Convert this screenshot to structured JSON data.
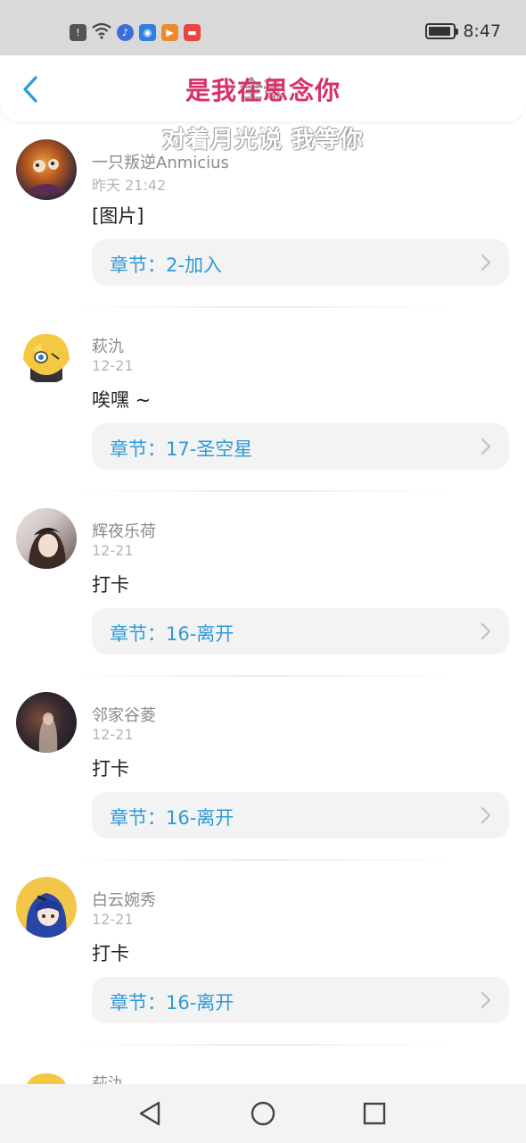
{
  "status_bar": {
    "time": "8:47",
    "battery_level": 0.9,
    "icons": [
      "alert-icon",
      "wifi-icon",
      "music-app-icon",
      "lightbulb-app-icon",
      "video-app-icon",
      "store-app-icon"
    ]
  },
  "header": {
    "title": "是我在思念你",
    "title_underlay": "全部",
    "subtitle": "对着月光说 我等你",
    "back_icon": "chevron-left-icon",
    "accent_color": "#d8306c"
  },
  "chapter_prefix": "章节：",
  "comments": [
    {
      "username": "一只叛逆Anmicius",
      "time": "昨天 21:42",
      "content": "[图片]",
      "chapter": "章节：2-加入"
    },
    {
      "username": "萩氿",
      "time": "12-21",
      "content": "唉嘿 ~",
      "chapter": "章节：17-圣空星"
    },
    {
      "username": "辉夜乐荷",
      "time": "12-21",
      "content": "打卡",
      "chapter": "章节：16-离开"
    },
    {
      "username": "邻家谷菱",
      "time": "12-21",
      "content": "打卡",
      "chapter": "章节：16-离开"
    },
    {
      "username": "白云婉秀",
      "time": "12-21",
      "content": "打卡",
      "chapter": "章节：16-离开"
    }
  ],
  "partial_comment": {
    "username": "萩氿"
  },
  "nav": {
    "back": "triangle-back-icon",
    "home": "circle-home-icon",
    "recent": "square-recent-icon"
  },
  "colors": {
    "link": "#2d9ad9",
    "chip_bg": "#f3f3f3"
  }
}
